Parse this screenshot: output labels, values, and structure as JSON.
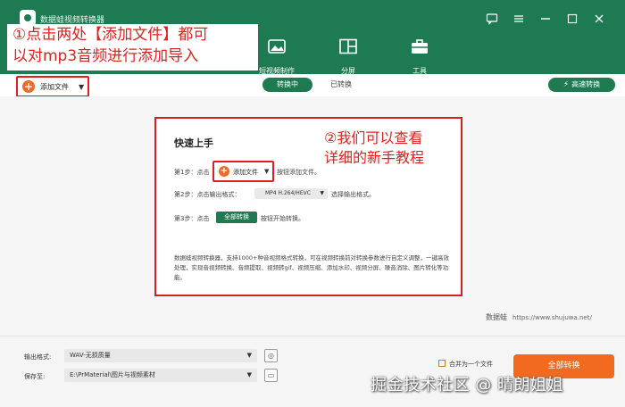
{
  "app": {
    "title": "数据蛙视频转换器",
    "window_controls": [
      "chat-icon",
      "menu-icon",
      "minimize-icon",
      "maximize-icon",
      "close-icon"
    ]
  },
  "nav": {
    "items": [
      {
        "label": "短视频制作",
        "icon": "image-icon"
      },
      {
        "label": "分屏",
        "icon": "split-screen-icon"
      },
      {
        "label": "工具",
        "icon": "toolbox-icon"
      }
    ]
  },
  "annotation1": {
    "line1": "①点击两处【添加文件】都可",
    "line2": "以对mp3音频进行添加导入"
  },
  "toolbar": {
    "add_file": "添加文件",
    "tab_converting": "转换中",
    "tab_converted": "已转换",
    "high_speed": "高速转换"
  },
  "quickstart": {
    "title": "快速上手",
    "step1_prefix": "第1步：点击",
    "step1_button": "添加文件",
    "step1_suffix": "按钮添加文件。",
    "step2_prefix": "第2步：点击输出格式：",
    "step2_format": "MP4 H.264/HEVC",
    "step2_suffix": "选择输出格式。",
    "step3_prefix": "第3步：点击",
    "step3_button": "全部转换",
    "step3_suffix": "按钮开始转换。",
    "description": "数据蛙视频转换器，支持1000+种音视频格式转换，可在视频转换前对转换参数进行自定义调整，一键高效处理，实现音视频转换、音频提取、视频转gif、视频压缩、添加水印、视频分屏、噪音消除、图片转化等功能。"
  },
  "annotation2": {
    "line1": "②我们可以查看",
    "line2": "详细的新手教程"
  },
  "site": {
    "brand": "数据蛙",
    "url": "https://www.shujuwa.net/"
  },
  "bottom": {
    "output_format_label": "输出格式:",
    "output_format_value": "WAV-无损质量",
    "save_to_label": "保存至:",
    "save_to_value": "E:\\PrMaterial\\图片与视频素材",
    "merge_label": "合并为一个文件",
    "convert_all": "全部转换"
  },
  "watermark": "掘金技术社区 @ 晴朗姐姐",
  "colors": {
    "brand_green": "#1e7a52",
    "accent_orange": "#f26a1f",
    "annotation_red": "#e0211b"
  }
}
